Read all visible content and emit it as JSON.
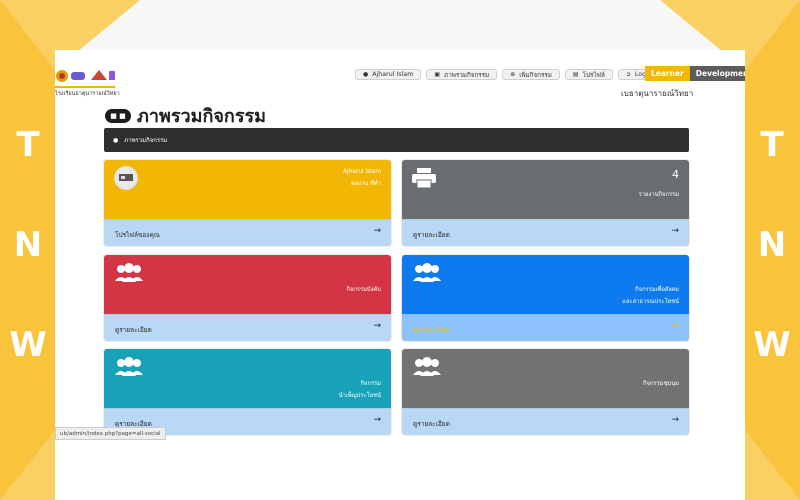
{
  "frame": {
    "left_letters": [
      "T",
      "N",
      "W"
    ],
    "right_letters": [
      "T",
      "N",
      "W"
    ],
    "accent_color": "#f9c33c"
  },
  "header": {
    "school_name": "โรงเรียนธาตุนารายณ์วิทยา",
    "tagline": "เบธาตุนารายณ์วิทยา",
    "nav": [
      {
        "icon": "user-icon",
        "label": "Ajharul Islam"
      },
      {
        "icon": "activity-icon",
        "label": "ภาพรวมกิจกรรม"
      },
      {
        "icon": "add-icon",
        "label": "เพิ่มกิจกรรม"
      },
      {
        "icon": "profile-card-icon",
        "label": "โปรไฟล์"
      },
      {
        "icon": "logout-icon",
        "label": "Logout"
      }
    ],
    "tabs": [
      "Learner",
      "Development",
      "A"
    ]
  },
  "page": {
    "title": "ภาพรวมกิจกรรม",
    "title_icon": "gamepad-icon",
    "breadcrumb": "ภาพรวมกิจกรรม"
  },
  "cards": [
    {
      "id": "profile",
      "right_lines": [
        "Ajharul Islam",
        "ผลงาน ที่ทำ"
      ],
      "footer": "โปรไฟล์ของคุณ",
      "color": "#f2b705"
    },
    {
      "id": "report",
      "count": "4",
      "right_lines": [
        "รายงานกิจกรรม"
      ],
      "footer": "ดูรายละเอียด",
      "color": "#6a6d70"
    },
    {
      "id": "events",
      "right_lines": [
        "กิจกรรมบังคับ"
      ],
      "footer": "ดูรายละเอียด",
      "color": "#d33545"
    },
    {
      "id": "development",
      "right_lines": [
        "กิจกรรมเพื่อสังคม",
        "และสาธารณประโยชน์"
      ],
      "footer": "ดูรายละเอียด",
      "color": "#0d7af0"
    },
    {
      "id": "public",
      "right_lines": [
        "กิจกรรม",
        "นำเพ็ญประโยชน์"
      ],
      "footer": "ดูรายละเอียด",
      "color": "#17a2b8"
    },
    {
      "id": "community",
      "right_lines": [
        "กิจกรรมชุมนุม"
      ],
      "footer": "ดูรายละเอียด",
      "color": "#727272"
    }
  ],
  "status_url": "ub/admin/index.php?page=all-social"
}
